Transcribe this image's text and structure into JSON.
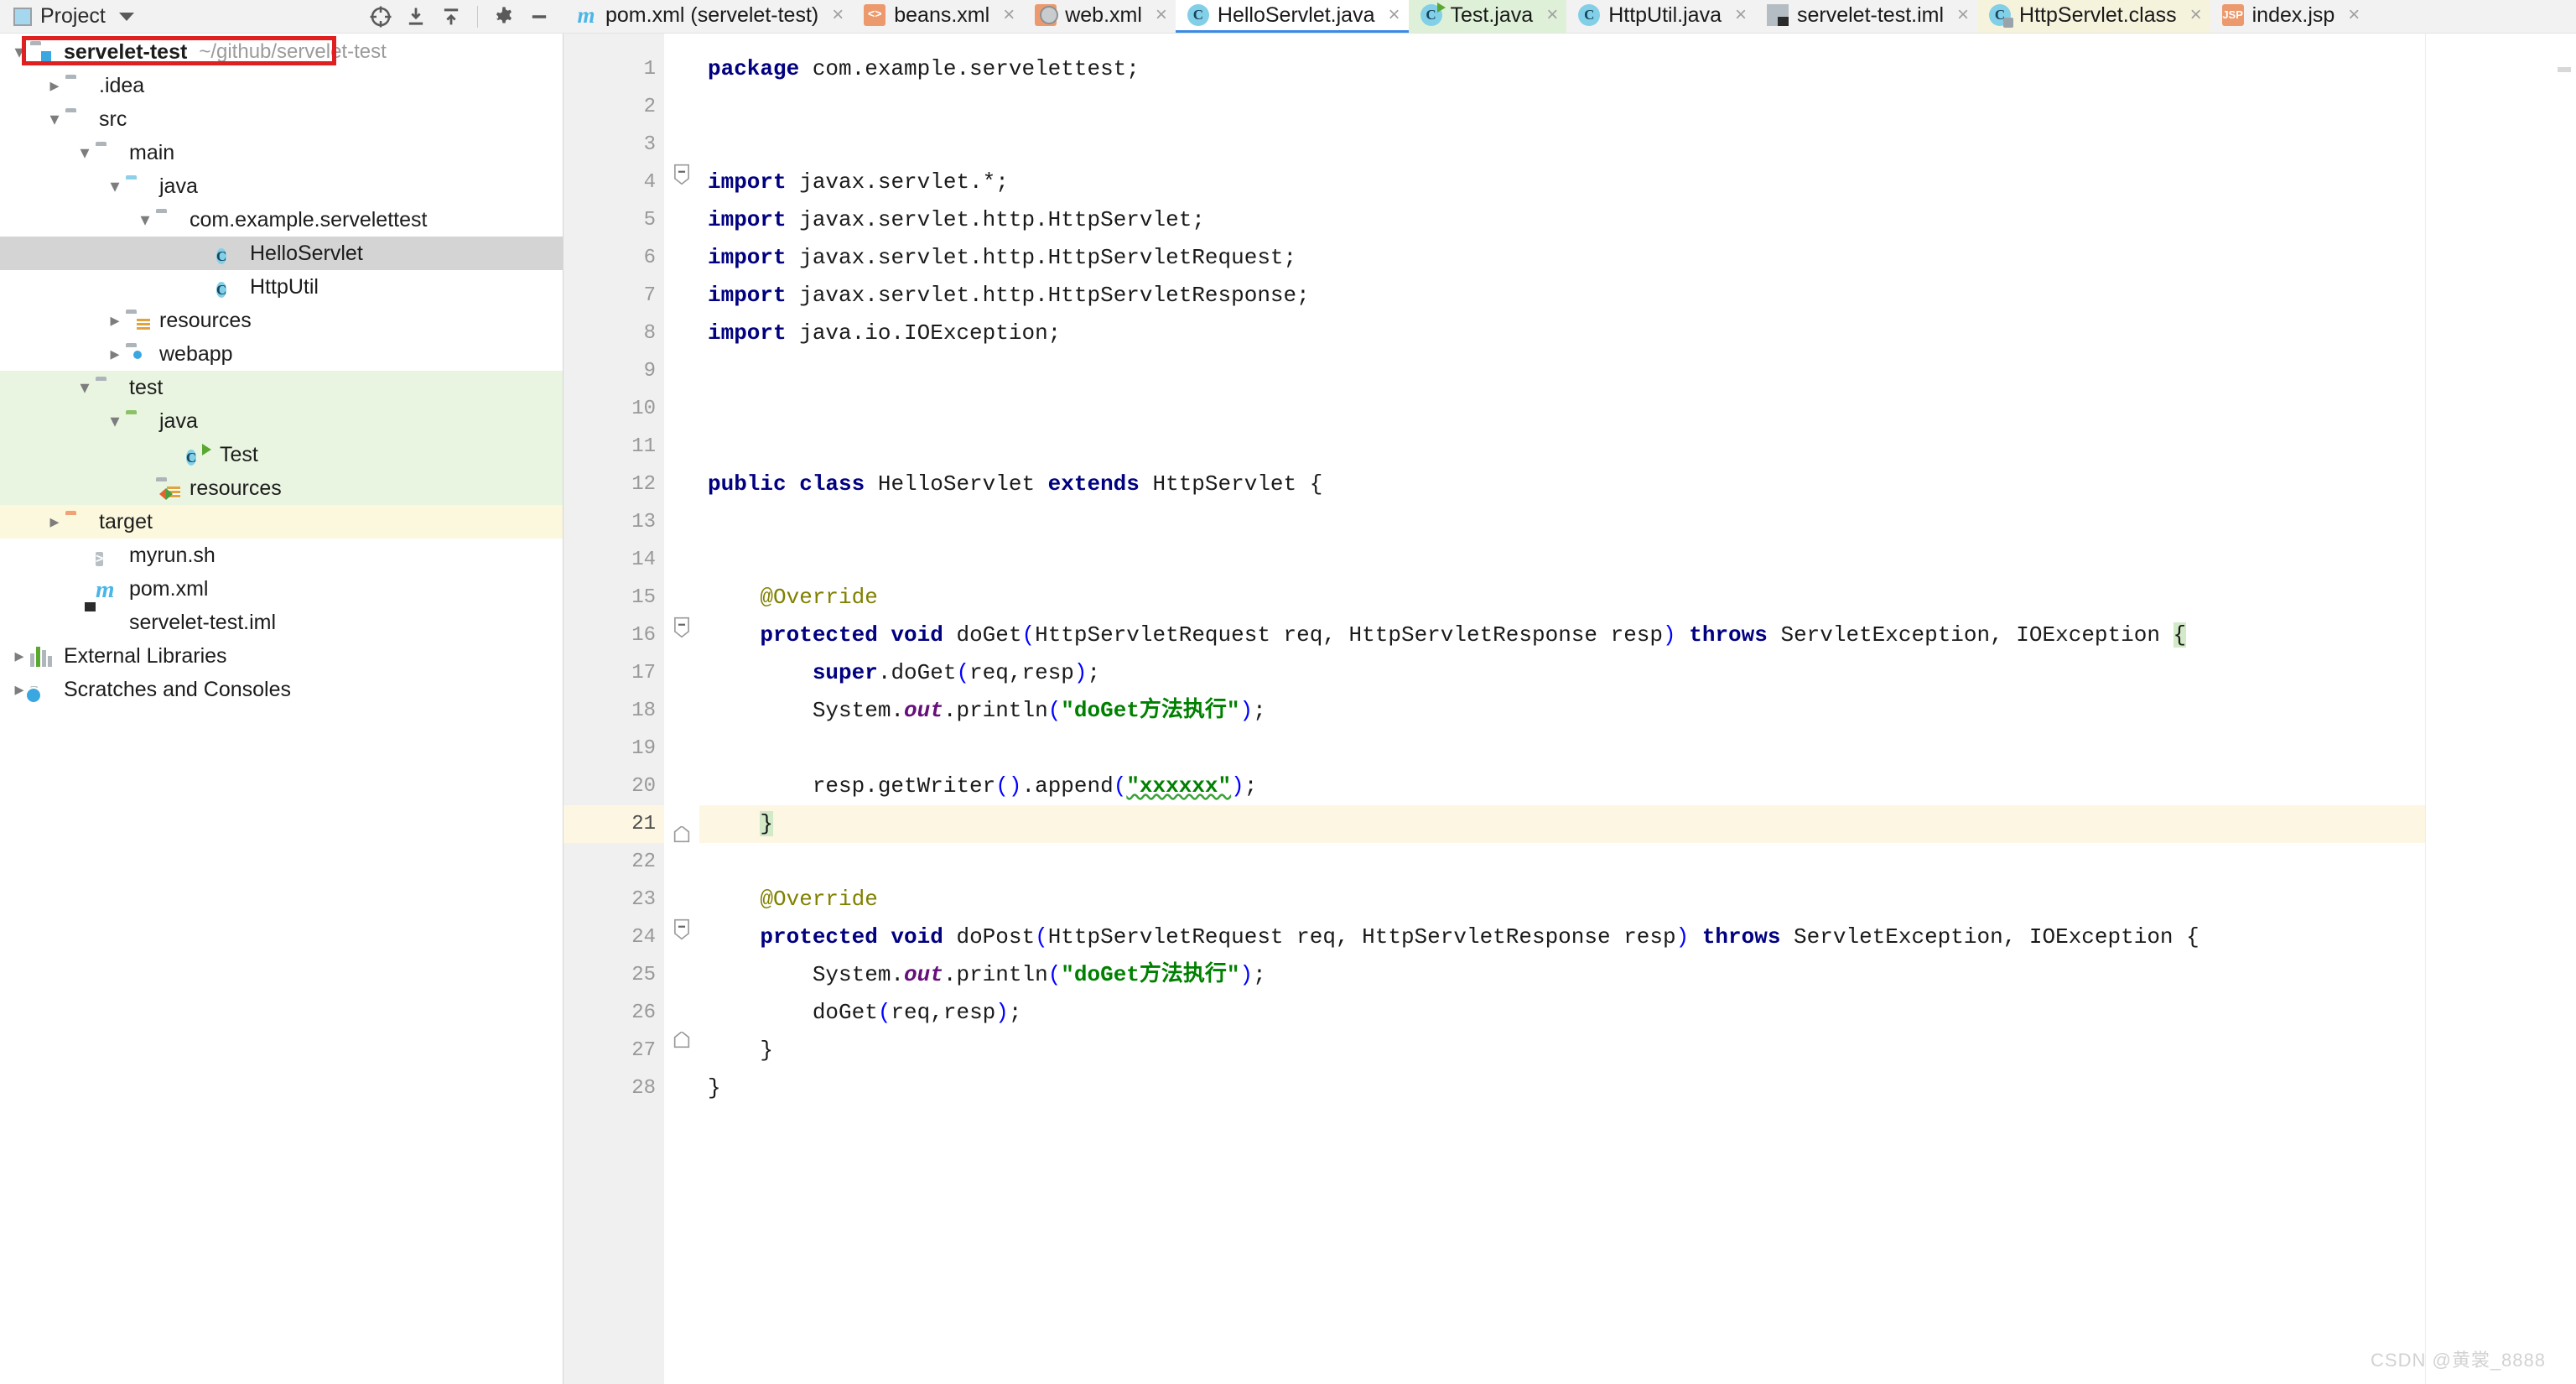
{
  "tool_window": {
    "title": "Project",
    "icon": "project-panel-icon",
    "caret": "chevron-down-icon",
    "actions": [
      {
        "name": "locate-icon",
        "label": ""
      },
      {
        "name": "expand-all-icon",
        "label": ""
      },
      {
        "name": "collapse-all-icon",
        "label": ""
      },
      {
        "name": "settings-gear-icon",
        "label": ""
      },
      {
        "name": "hide-icon",
        "label": ""
      }
    ]
  },
  "tabs": [
    {
      "label": "pom.xml (servelet-test)",
      "icon": "maven-icon",
      "active": false,
      "style": "normal",
      "close": "×"
    },
    {
      "label": "beans.xml",
      "icon": "xml-icon",
      "active": false,
      "style": "normal",
      "close": "×"
    },
    {
      "label": "web.xml",
      "icon": "web-xml-icon",
      "active": false,
      "style": "normal",
      "close": "×"
    },
    {
      "label": "HelloServlet.java",
      "icon": "java-class-icon",
      "active": true,
      "style": "active",
      "close": "×"
    },
    {
      "label": "Test.java",
      "icon": "java-test-class-icon",
      "active": false,
      "style": "test",
      "close": "×"
    },
    {
      "label": "HttpUtil.java",
      "icon": "java-class-icon",
      "active": false,
      "style": "normal",
      "close": "×"
    },
    {
      "label": "servelet-test.iml",
      "icon": "iml-file-icon",
      "active": false,
      "style": "normal",
      "close": "×"
    },
    {
      "label": "HttpServlet.class",
      "icon": "class-file-icon",
      "active": false,
      "style": "classfile",
      "close": "×"
    },
    {
      "label": "index.jsp",
      "icon": "jsp-icon",
      "active": false,
      "style": "normal",
      "close": "×"
    }
  ],
  "project_tree": [
    {
      "label": "servelet-test",
      "path": "~/github/servelet-test",
      "indent": 0,
      "arrow": "expanded",
      "icon": "module-folder-icon",
      "state": "highlighted",
      "bold": true
    },
    {
      "label": ".idea",
      "indent": 1,
      "arrow": "collapsed",
      "icon": "folder-gray-icon",
      "state": "normal"
    },
    {
      "label": "src",
      "indent": 1,
      "arrow": "expanded",
      "icon": "folder-gray-icon",
      "state": "normal"
    },
    {
      "label": "main",
      "indent": 2,
      "arrow": "expanded",
      "icon": "folder-gray-icon",
      "state": "normal"
    },
    {
      "label": "java",
      "indent": 3,
      "arrow": "expanded",
      "icon": "folder-source-icon",
      "state": "normal"
    },
    {
      "label": "com.example.servelettest",
      "indent": 4,
      "arrow": "expanded",
      "icon": "package-icon",
      "state": "normal"
    },
    {
      "label": "HelloServlet",
      "indent": 5,
      "arrow": "none",
      "icon": "java-class-icon",
      "state": "selected"
    },
    {
      "label": "HttpUtil",
      "indent": 5,
      "arrow": "none",
      "icon": "java-class-icon",
      "state": "normal"
    },
    {
      "label": "resources",
      "indent": 3,
      "arrow": "collapsed",
      "icon": "folder-resources-icon",
      "state": "normal"
    },
    {
      "label": "webapp",
      "indent": 3,
      "arrow": "collapsed",
      "icon": "folder-webapp-icon",
      "state": "normal"
    },
    {
      "label": "test",
      "indent": 2,
      "arrow": "expanded",
      "icon": "folder-gray-icon",
      "state": "test"
    },
    {
      "label": "java",
      "indent": 3,
      "arrow": "expanded",
      "icon": "folder-test-source-icon",
      "state": "test"
    },
    {
      "label": "Test",
      "indent": 4,
      "arrow": "none",
      "icon": "java-test-class-icon",
      "state": "test"
    },
    {
      "label": "resources",
      "indent": 3,
      "arrow": "none",
      "icon": "folder-test-resources-icon",
      "state": "test"
    },
    {
      "label": "target",
      "indent": 1,
      "arrow": "collapsed",
      "icon": "folder-excluded-icon",
      "state": "excluded"
    },
    {
      "label": "myrun.sh",
      "indent": 2,
      "arrow": "none",
      "icon": "shell-script-icon",
      "state": "normal"
    },
    {
      "label": "pom.xml",
      "indent": 2,
      "arrow": "none",
      "icon": "maven-icon",
      "state": "normal"
    },
    {
      "label": "servelet-test.iml",
      "indent": 2,
      "arrow": "none",
      "icon": "iml-file-icon",
      "state": "normal"
    },
    {
      "label": "External Libraries",
      "indent": 0,
      "arrow": "collapsed",
      "icon": "libraries-icon",
      "state": "normal"
    },
    {
      "label": "Scratches and Consoles",
      "indent": 0,
      "arrow": "collapsed",
      "icon": "scratches-icon",
      "state": "normal"
    }
  ],
  "editor": {
    "file": "HelloServlet.java",
    "current_line": 21,
    "line_numbers": [
      1,
      2,
      3,
      4,
      5,
      6,
      7,
      8,
      9,
      10,
      11,
      12,
      13,
      14,
      15,
      16,
      17,
      18,
      19,
      20,
      21,
      22,
      23,
      24,
      25,
      26,
      27,
      28
    ],
    "lines": [
      "package com.example.servelettest;",
      "",
      "",
      "import javax.servlet.*;",
      "import javax.servlet.http.HttpServlet;",
      "import javax.servlet.http.HttpServletRequest;",
      "import javax.servlet.http.HttpServletResponse;",
      "import java.io.IOException;",
      "",
      "",
      "",
      "public class HelloServlet extends HttpServlet {",
      "",
      "",
      "    @Override",
      "    protected void doGet(HttpServletRequest req, HttpServletResponse resp) throws ServletException, IOException {",
      "        super.doGet(req,resp);",
      "        System.out.println(\"doGet方法执行\");",
      "",
      "        resp.getWriter().append(\"xxxxxx\");",
      "    }",
      "",
      "    @Override",
      "    protected void doPost(HttpServletRequest req, HttpServletResponse resp) throws ServletException, IOException {",
      "        System.out.println(\"doGet方法执行\");",
      "        doGet(req,resp);",
      "    }",
      "}"
    ],
    "gutter_marks": [
      {
        "line": 12,
        "name": "class-marker-icon"
      },
      {
        "line": 16,
        "name": "override-method-icon"
      },
      {
        "line": 24,
        "name": "override-method-icon"
      }
    ]
  },
  "watermark": "CSDN @黄裳_8888"
}
